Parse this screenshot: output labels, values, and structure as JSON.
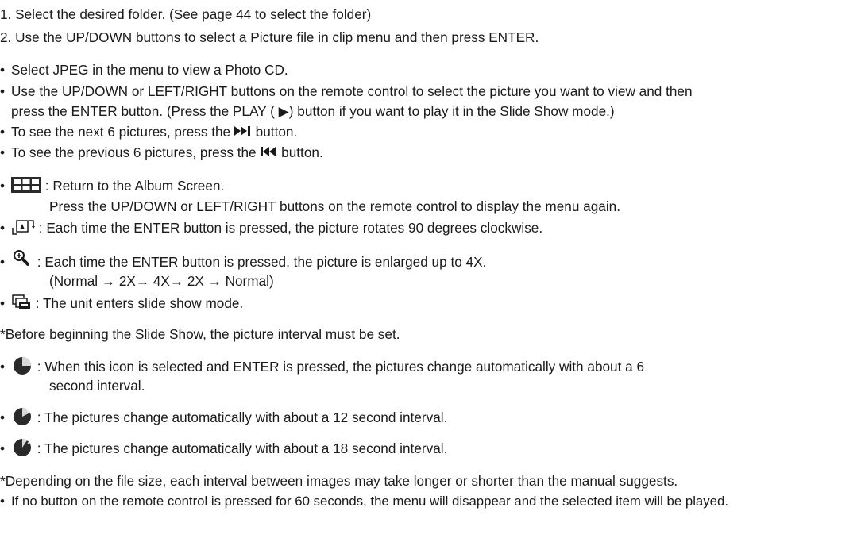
{
  "steps": [
    "1. Select the desired folder. (See page 44 to select the folder)",
    "2. Use the UP/DOWN buttons to select a Picture file in clip menu and then press ENTER."
  ],
  "bullets": {
    "jpeg": "Select JPEG in the menu to view a Photo CD.",
    "updown_1": "Use the UP/DOWN or LEFT/RIGHT buttons on the remote control to select the picture you want to view and then",
    "updown_2": "press the ENTER button. (Press the PLAY ( ▶) button if you want to play it in the Slide Show mode.)",
    "next_a": "To see the next 6 pictures, press the",
    "next_b": "button.",
    "prev_a": "To see the previous 6 pictures, press the",
    "prev_b": "button."
  },
  "icon_items": {
    "album_1": ": Return to the Album Screen.",
    "album_2": "Press the UP/DOWN or LEFT/RIGHT buttons on the remote control to display the menu again.",
    "rotate": ": Each time the ENTER button is pressed, the picture rotates 90 degrees clockwise.",
    "zoom_1": ": Each time the ENTER button is pressed, the picture is enlarged up to 4X.",
    "zoom_2": "(Normal → 2X→ 4X→ 2X → Normal)",
    "slideshow": ": The unit enters slide show mode."
  },
  "note_interval": "*Before beginning the Slide Show, the picture interval must be set.",
  "interval_items": {
    "i6_1": ": When this icon is selected and ENTER is pressed, the pictures change automatically with about a 6",
    "i6_2": "second interval.",
    "i12": ": The pictures change automatically with about a 12 second interval.",
    "i18": ": The pictures change automatically with about a 18 second interval."
  },
  "note_filesize": "*Depending on the file size, each interval between images may take longer or shorter than the manual suggests.",
  "note_timeout": "If no button on the remote control is pressed for 60 seconds, the menu will disappear and the selected item will be played.",
  "bullet_char": "•",
  "icon_color": "#2a2a2a"
}
